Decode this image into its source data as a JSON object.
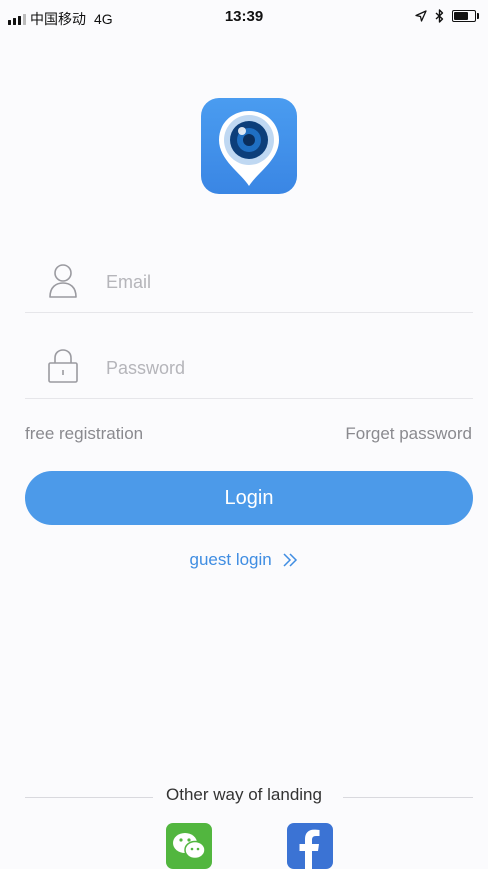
{
  "status_bar": {
    "carrier": "中国移动",
    "network": "4G",
    "time": "13:39",
    "battery_level": 0.75
  },
  "login": {
    "email_placeholder": "Email",
    "password_placeholder": "Password",
    "free_registration": "free registration",
    "forget_password": "Forget password",
    "login_button": "Login",
    "guest_login": "guest login"
  },
  "other": {
    "label": "Other way of landing"
  },
  "colors": {
    "accent": "#4c9ae9",
    "wechat": "#52b63f",
    "facebook": "#3b73d4"
  }
}
